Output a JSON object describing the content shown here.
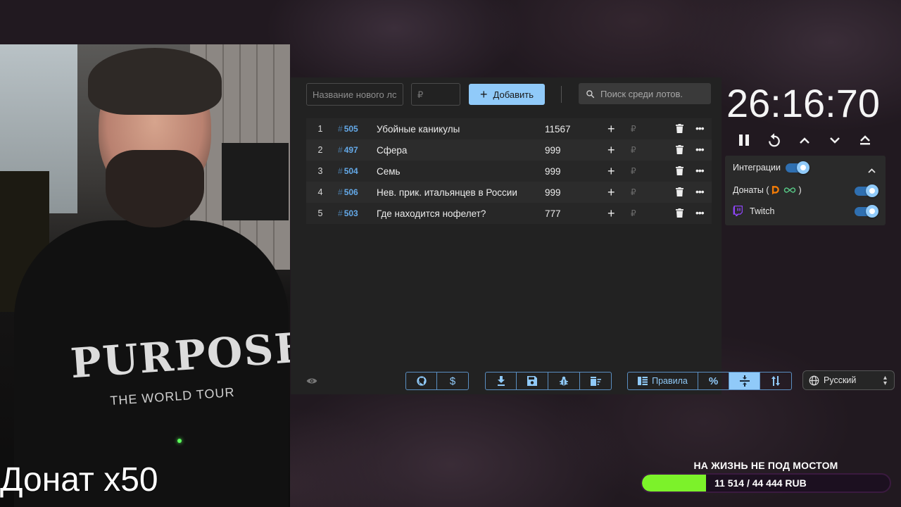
{
  "webcam": {
    "shirt_brand": "PURPOSE",
    "shirt_sub": "THE WORLD TOUR"
  },
  "overlay": {
    "donate_multiplier": "Донат x50"
  },
  "toolbar": {
    "name_placeholder": "Название нового лс",
    "price_placeholder": "₽",
    "add_label": "Добавить",
    "search_placeholder": "Поиск среди лотов."
  },
  "lots": [
    {
      "num": "1",
      "id": "505",
      "name": "Убойные каникулы",
      "amount": "11567"
    },
    {
      "num": "2",
      "id": "497",
      "name": "Сфера",
      "amount": "999"
    },
    {
      "num": "3",
      "id": "504",
      "name": "Семь",
      "amount": "999"
    },
    {
      "num": "4",
      "id": "506",
      "name": "Нев. прик. итальянцев в России",
      "amount": "999"
    },
    {
      "num": "5",
      "id": "503",
      "name": "Где находится нофелет?",
      "amount": "777"
    }
  ],
  "lot_currency": "₽",
  "bottom": {
    "rules_label": "Правила",
    "percent_label": "%",
    "language": "Русский"
  },
  "timer": {
    "value": "26:16:70"
  },
  "integrations": {
    "title": "Интеграции",
    "enabled": true,
    "items": [
      {
        "label_prefix": "Донаты (",
        "label_suffix": ")",
        "enabled": true
      },
      {
        "label": "Twitch",
        "enabled": true
      }
    ]
  },
  "goal": {
    "title": "НА ЖИЗНЬ НЕ ПОД МОСТОМ",
    "progress_text": "11 514 / 44 444 RUB",
    "current": 11514,
    "target": 44444
  },
  "colors": {
    "accent": "#90caf9",
    "lot_id": "#64a9e8",
    "goal_fill": "#7cf22a",
    "twitch": "#9146ff",
    "donationalerts": "#f57d07"
  }
}
